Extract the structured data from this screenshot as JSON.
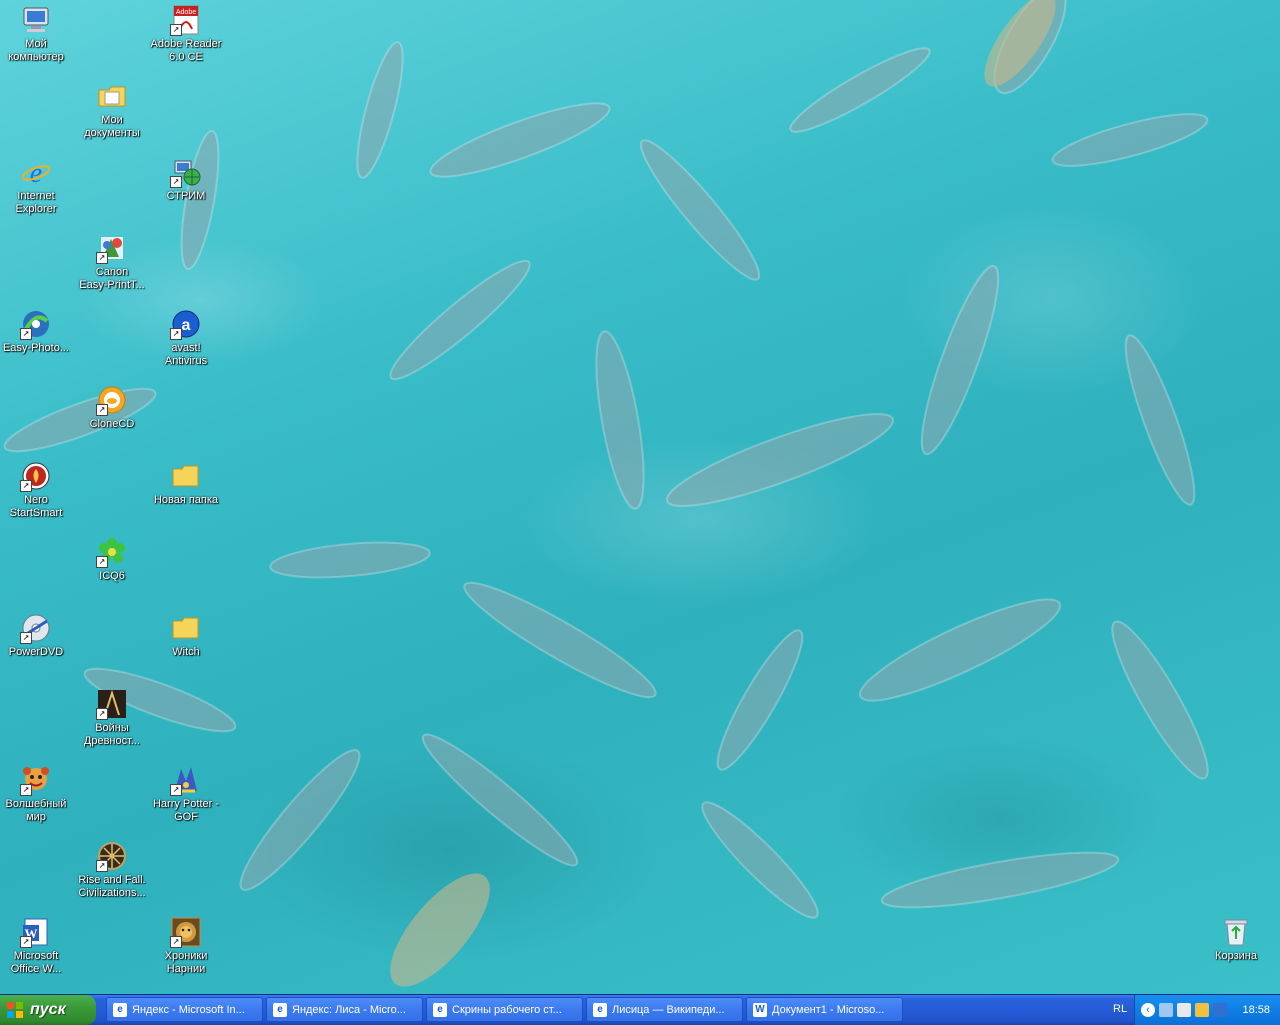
{
  "desktop": {
    "icons": [
      {
        "label": "Мой\nкомпьютер",
        "icon": "computer-icon",
        "shortcut": false
      },
      {
        "label": "Adobe Reader\n6.0 CE",
        "icon": "pdf-icon",
        "shortcut": true
      },
      {
        "label": "Мои\nдокументы",
        "icon": "documents-folder-icon",
        "shortcut": false
      },
      {
        "label": "Internet\nExplorer",
        "icon": "ie-icon",
        "shortcut": false
      },
      {
        "label": "СТРИМ",
        "icon": "network-icon",
        "shortcut": true
      },
      {
        "label": "Canon\nEasy-PrintT...",
        "icon": "canon-icon",
        "shortcut": true
      },
      {
        "label": "Easy-Photo...",
        "icon": "photo-icon",
        "shortcut": true
      },
      {
        "label": "avast!\nAntivirus",
        "icon": "avast-icon",
        "shortcut": true
      },
      {
        "label": "CloneCD",
        "icon": "clonecd-icon",
        "shortcut": true
      },
      {
        "label": "Nero\nStartSmart",
        "icon": "nero-icon",
        "shortcut": true
      },
      {
        "label": "Новая папка",
        "icon": "folder-icon",
        "shortcut": false
      },
      {
        "label": "ICQ6",
        "icon": "icq-icon",
        "shortcut": true
      },
      {
        "label": "PowerDVD",
        "icon": "dvd-icon",
        "shortcut": true
      },
      {
        "label": "Witch",
        "icon": "folder-icon",
        "shortcut": false
      },
      {
        "label": "Войны\nДревност...",
        "icon": "game-icon",
        "shortcut": true
      },
      {
        "label": "Волшебный\nмир",
        "icon": "game-icon",
        "shortcut": true
      },
      {
        "label": "Harry Potter -\nGOF",
        "icon": "game-icon",
        "shortcut": true
      },
      {
        "label": "Rise and Fall.\nCivilizations...",
        "icon": "game-icon",
        "shortcut": true
      },
      {
        "label": "Microsoft\nOffice W...",
        "icon": "word-icon",
        "shortcut": true
      },
      {
        "label": "Хроники\nНарнии",
        "icon": "game-icon",
        "shortcut": true
      },
      {
        "label": "Корзина",
        "icon": "recycle-bin-icon",
        "shortcut": false
      }
    ]
  },
  "taskbar": {
    "start_label": "пуск",
    "tasks": [
      {
        "label": "Яндекс - Microsoft In...",
        "icon": "ie-icon"
      },
      {
        "label": "Яндекс: Лиса - Micro...",
        "icon": "ie-icon"
      },
      {
        "label": "Скрины рабочего ст...",
        "icon": "ie-icon"
      },
      {
        "label": "Лисица — Википеди...",
        "icon": "ie-icon"
      },
      {
        "label": "Документ1 - Microso...",
        "icon": "word-icon"
      }
    ],
    "tray": {
      "language": "RL",
      "clock": "18:58"
    }
  },
  "colors": {
    "water": "#37b8c4",
    "taskbar_blue": "#245bd6",
    "start_green": "#3c9a3a",
    "tray_blue": "#0f7fe6"
  }
}
